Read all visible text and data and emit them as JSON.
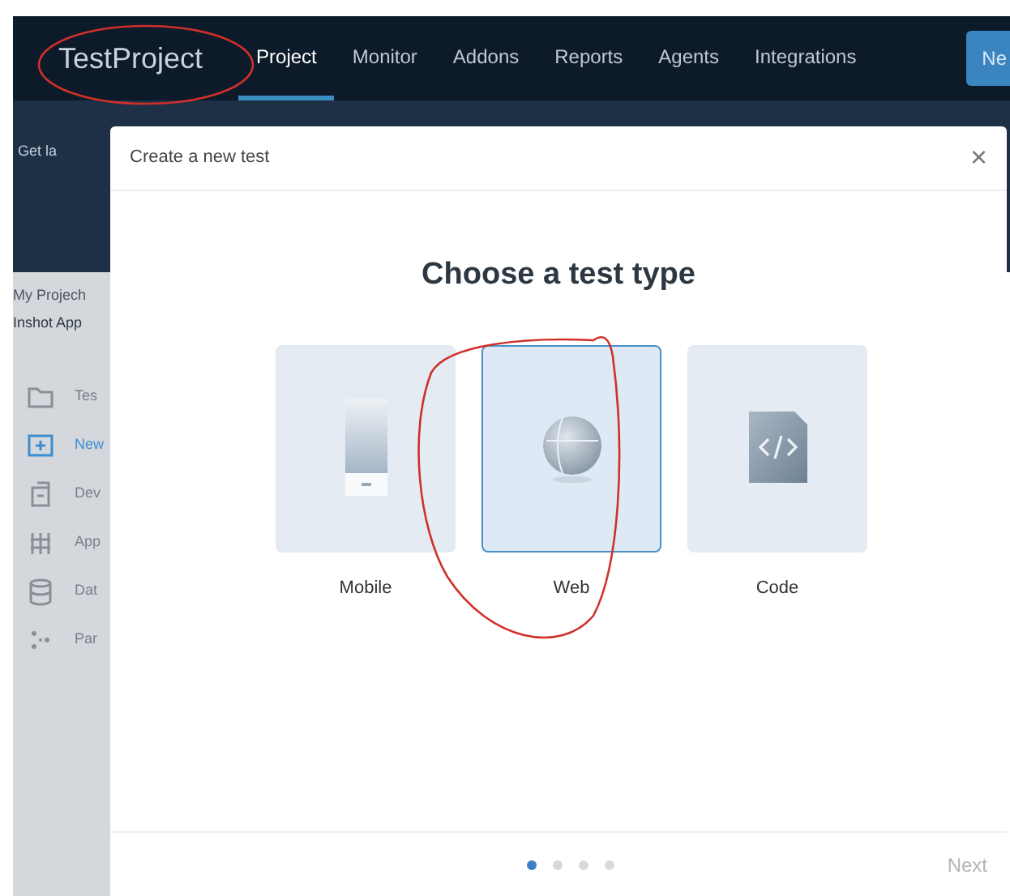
{
  "logo": "TestProject",
  "nav": [
    {
      "label": "Project",
      "selected": true
    },
    {
      "label": "Monitor",
      "selected": false
    },
    {
      "label": "Addons",
      "selected": false
    },
    {
      "label": "Reports",
      "selected": false
    },
    {
      "label": "Agents",
      "selected": false
    },
    {
      "label": "Integrations",
      "selected": false
    }
  ],
  "nav_button": "Ne",
  "banner": {
    "text": "Get la"
  },
  "sidebar": {
    "project_label": "My Projech",
    "project_name": "Inshot App",
    "items": [
      {
        "label": "Tes",
        "kind": "folder",
        "selected": false
      },
      {
        "label": "New",
        "kind": "add",
        "selected": true
      },
      {
        "label": "Dev",
        "kind": "device",
        "selected": false
      },
      {
        "label": "App",
        "kind": "grid",
        "selected": false
      },
      {
        "label": "Dat",
        "kind": "data",
        "selected": false
      },
      {
        "label": "Par",
        "kind": "params",
        "selected": false
      }
    ]
  },
  "dialog": {
    "title": "Create a new test",
    "close": "×",
    "heading": "Choose a test type",
    "options": [
      {
        "kind": "mobile",
        "label": "Mobile",
        "selected": false
      },
      {
        "kind": "web",
        "label": "Web",
        "selected": true
      },
      {
        "kind": "code",
        "label": "Code",
        "selected": false
      }
    ],
    "steps": [
      {
        "selected": true
      },
      {
        "selected": false
      },
      {
        "selected": false
      },
      {
        "selected": false
      }
    ],
    "next": {
      "label": "Next",
      "disabled": true
    }
  }
}
